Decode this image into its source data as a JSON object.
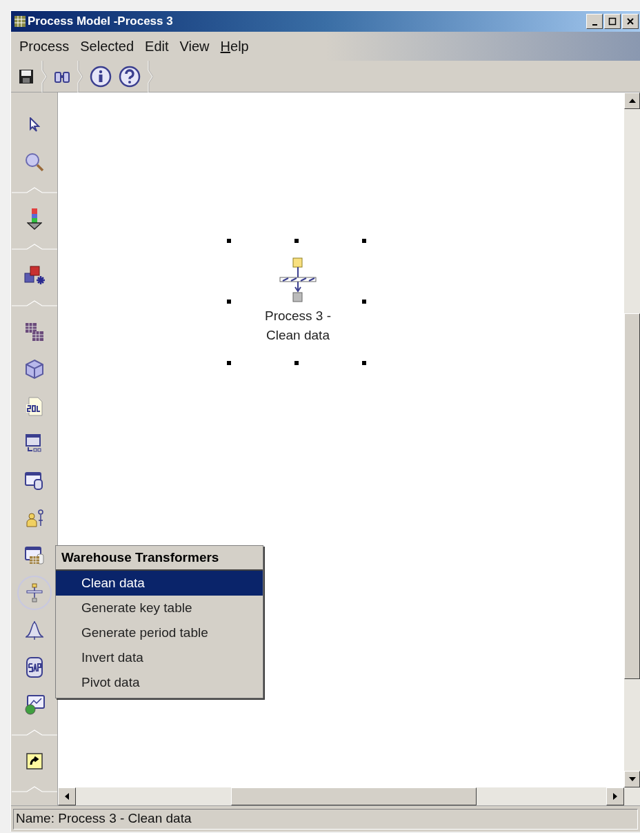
{
  "window": {
    "title": "Process Model -Process 3"
  },
  "menu_bar": [
    {
      "label": "Process",
      "mnemonic": false
    },
    {
      "label": "Selected",
      "mnemonic": false
    },
    {
      "label": "Edit",
      "mnemonic": false
    },
    {
      "label": "View",
      "mnemonic": false
    },
    {
      "label": "Help",
      "mnemonic": true
    }
  ],
  "toolbar": [
    {
      "kind": "save"
    },
    {
      "kind": "separator"
    },
    {
      "kind": "find"
    },
    {
      "kind": "separator"
    },
    {
      "kind": "info"
    },
    {
      "kind": "help"
    },
    {
      "kind": "separator"
    }
  ],
  "palette": [
    {
      "kind": "pointer",
      "selected": false
    },
    {
      "kind": "zoom",
      "selected": false
    },
    {
      "kind": "separator"
    },
    {
      "kind": "source",
      "selected": false
    },
    {
      "kind": "separator"
    },
    {
      "kind": "shapes",
      "selected": false
    },
    {
      "kind": "separator"
    },
    {
      "kind": "tables",
      "selected": false
    },
    {
      "kind": "cube",
      "selected": false
    },
    {
      "kind": "sql",
      "selected": false
    },
    {
      "kind": "command",
      "selected": false
    },
    {
      "kind": "database",
      "selected": false
    },
    {
      "kind": "user",
      "selected": false
    },
    {
      "kind": "grid-db",
      "selected": false
    },
    {
      "kind": "transformer",
      "selected": true
    },
    {
      "kind": "statistics",
      "selected": false
    },
    {
      "kind": "sap",
      "selected": false
    },
    {
      "kind": "web",
      "selected": false
    },
    {
      "kind": "separator"
    },
    {
      "kind": "shortcut",
      "selected": false
    },
    {
      "kind": "separator"
    }
  ],
  "canvas": {
    "node": {
      "label_lines": [
        "Process 3 -",
        "Clean data"
      ],
      "selected": true
    }
  },
  "popup_menu": {
    "title": "Warehouse Transformers",
    "items": [
      {
        "label": "Clean data",
        "selected": true
      },
      {
        "label": "Generate key table",
        "selected": false
      },
      {
        "label": "Generate period table",
        "selected": false
      },
      {
        "label": "Invert data",
        "selected": false
      },
      {
        "label": "Pivot data",
        "selected": false
      }
    ]
  },
  "status_bar": {
    "text": "Name: Process 3 - Clean data"
  }
}
